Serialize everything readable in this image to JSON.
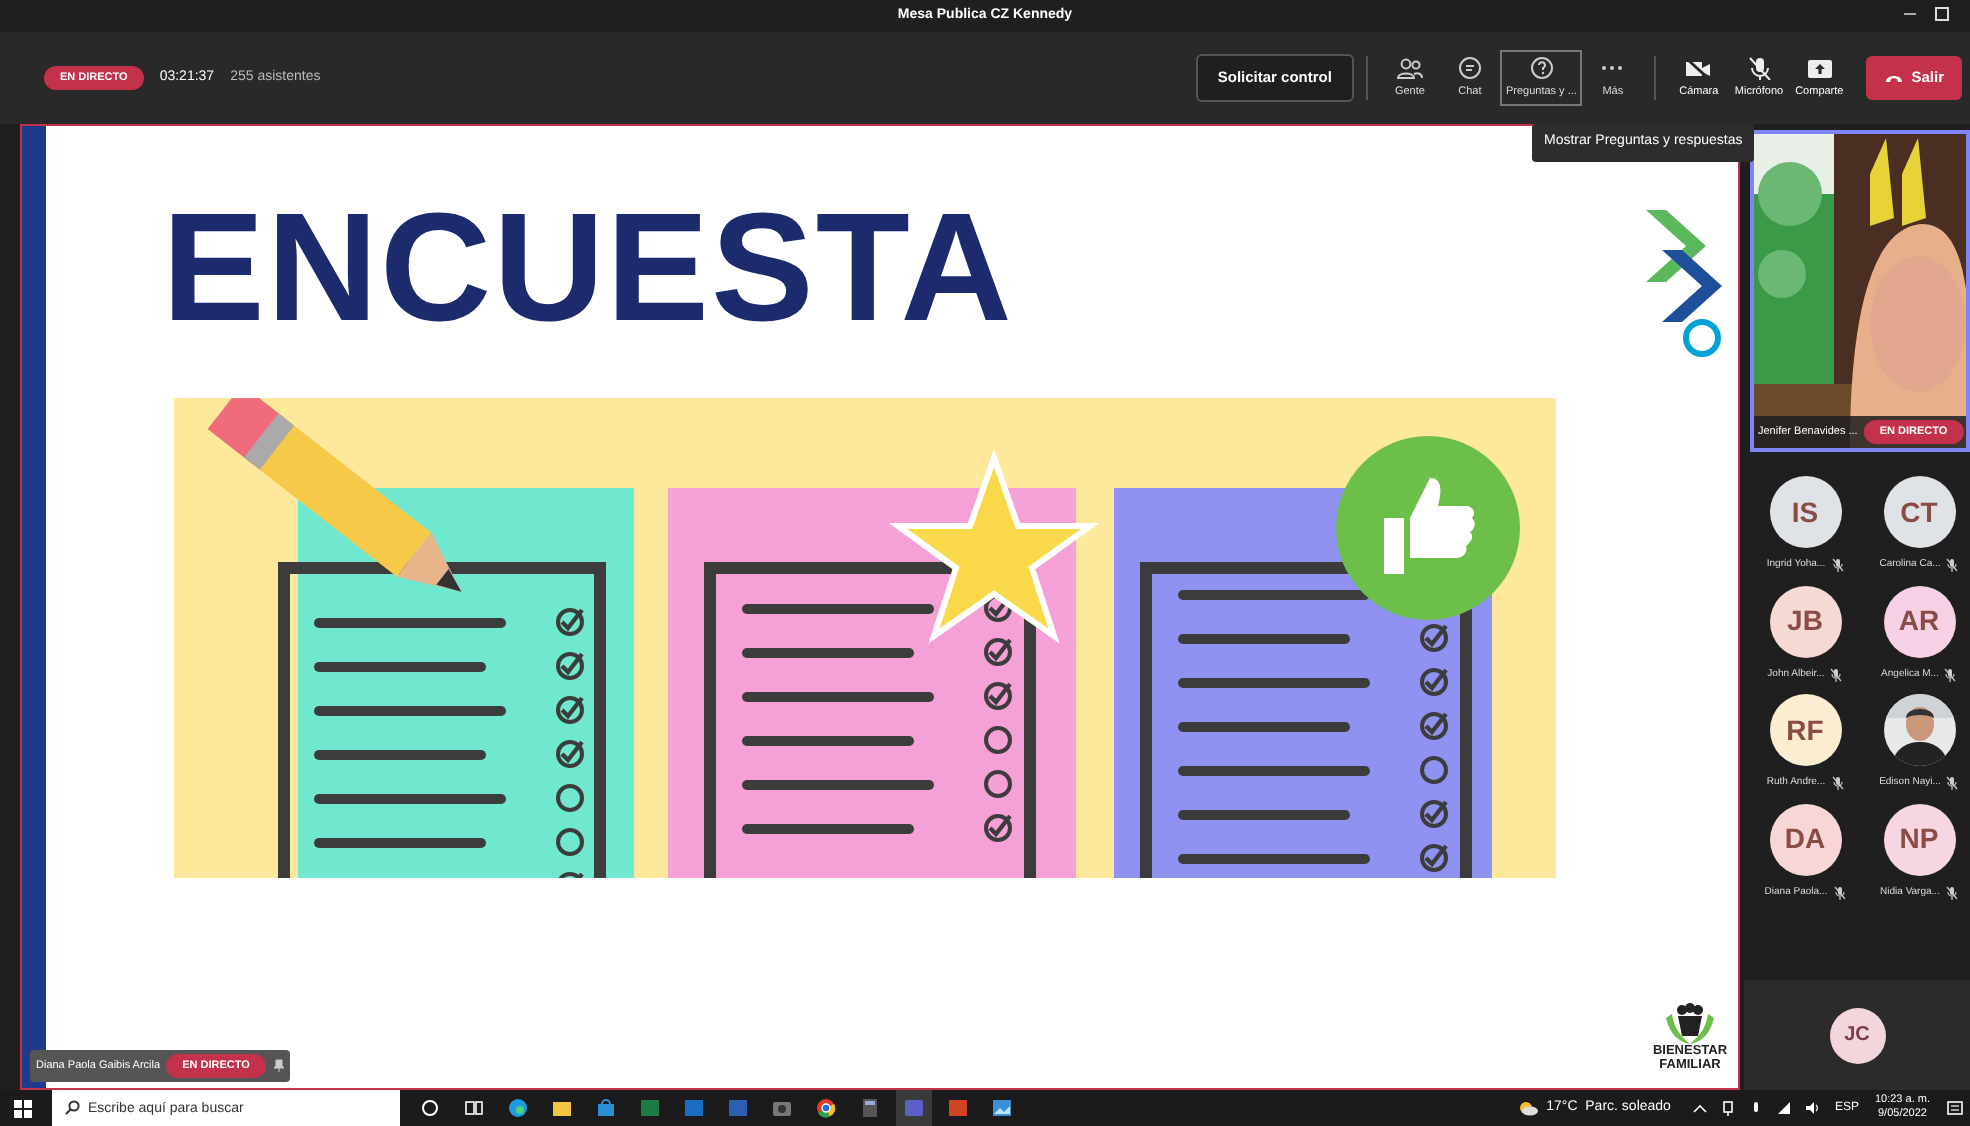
{
  "window": {
    "title": "Mesa Publica CZ Kennedy"
  },
  "meeting_bar": {
    "live_badge": "EN DIRECTO",
    "elapsed": "03:21:37",
    "attendees": "255 asistentes",
    "request_control": "Solicitar control",
    "tools": [
      {
        "kind": "people",
        "label": "Gente",
        "selected": false
      },
      {
        "kind": "chat",
        "label": "Chat",
        "selected": false
      },
      {
        "kind": "questions",
        "label": "Preguntas y ...",
        "selected": true
      },
      {
        "kind": "more",
        "label": "Más",
        "selected": false
      }
    ],
    "devices": [
      {
        "kind": "camera",
        "label": "Cámara"
      },
      {
        "kind": "mic",
        "label": "Micrófono"
      },
      {
        "kind": "share",
        "label": "Comparte"
      }
    ],
    "leave": "Salir"
  },
  "tooltip": "Mostrar Preguntas y respuestas",
  "slide": {
    "title": "ENCUESTA",
    "logo_lines": [
      "BIENESTAR",
      "FAMILIAR"
    ]
  },
  "presenter_label": {
    "name": "Diana Paola Gaibis Arcila",
    "badge": "EN DIRECTO"
  },
  "featured_video": {
    "kind": "picture",
    "name": "Jenifer Benavides ...",
    "badge": "EN DIRECTO"
  },
  "participants": [
    {
      "kind": "initials",
      "initials": "IS",
      "name": "Ingrid Yoha...",
      "color": "#dfe3e8"
    },
    {
      "kind": "initials",
      "initials": "CT",
      "name": "Carolina Ca...",
      "color": "#dfe3e8"
    },
    {
      "kind": "initials",
      "initials": "JB",
      "name": "John Albeir...",
      "color": "#f6d9d2"
    },
    {
      "kind": "initials",
      "initials": "AR",
      "name": "Angelica M...",
      "color": "#f6d0e4"
    },
    {
      "kind": "initials",
      "initials": "RF",
      "name": "Ruth Andre...",
      "color": "#fbecd2"
    },
    {
      "kind": "picture",
      "name": "Edison Nayi..."
    },
    {
      "kind": "initials",
      "initials": "DA",
      "name": "Diana Paola...",
      "color": "#f6d6d6"
    },
    {
      "kind": "initials",
      "initials": "NP",
      "name": "Nidia Varga...",
      "color": "#f6d6e2"
    }
  ],
  "overflow": [
    {
      "initials": "JC",
      "color": "#f3d6dc"
    }
  ],
  "taskbar": {
    "search_placeholder": "Escribe aquí para buscar",
    "weather": "17°C  Parc. soleado",
    "lang": "ESP",
    "time": "10:23 a. m.",
    "date": "9/05/2022"
  }
}
